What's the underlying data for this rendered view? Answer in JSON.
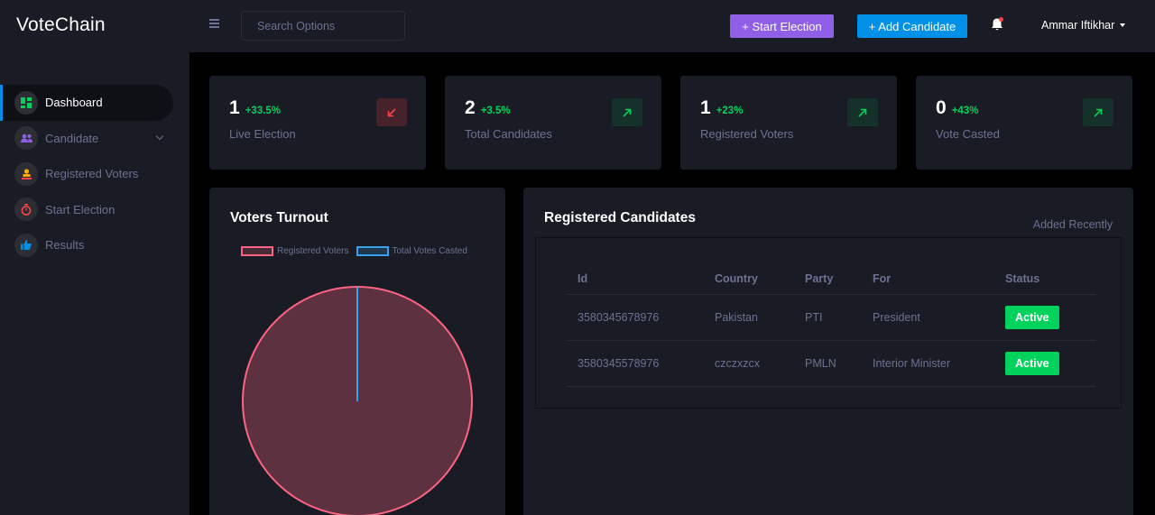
{
  "brand": "VoteChain",
  "sidebar": {
    "items": [
      {
        "label": "Dashboard",
        "icon": "grid-icon",
        "active": true
      },
      {
        "label": "Candidate",
        "icon": "users-icon",
        "has_dropdown": true
      },
      {
        "label": "Registered Voters",
        "icon": "voter-icon"
      },
      {
        "label": "Start Election",
        "icon": "timer-icon"
      },
      {
        "label": "Results",
        "icon": "thumbs-up-icon"
      }
    ]
  },
  "topbar": {
    "search_placeholder": "Search Options",
    "start_election_label": "+ Start Election",
    "add_candidate_label": "+ Add Candidate",
    "user_name": "Ammar Iftikhar"
  },
  "stats": [
    {
      "value": "1",
      "change": "+33.5%",
      "label": "Live Election",
      "trend": "down"
    },
    {
      "value": "2",
      "change": "+3.5%",
      "label": "Total Candidates",
      "trend": "up"
    },
    {
      "value": "1",
      "change": "+23%",
      "label": "Registered Voters",
      "trend": "up"
    },
    {
      "value": "0",
      "change": "+43%",
      "label": "Vote Casted",
      "trend": "up"
    }
  ],
  "turnout": {
    "title": "Voters Turnout",
    "chart_data": {
      "type": "pie",
      "labels": [
        "Registered Voters",
        "Total Votes Casted"
      ],
      "values": [
        1,
        0
      ],
      "colors": [
        "#ff6384",
        "#36a2eb"
      ],
      "legend": "top"
    }
  },
  "candidates": {
    "title": "Registered Candidates",
    "subtitle": "Added Recently",
    "columns": [
      "Id",
      "Country",
      "Party",
      "For",
      "Status"
    ],
    "rows": [
      {
        "id": "3580345678976",
        "country": "Pakistan",
        "party": "PTI",
        "for": "President",
        "status": "Active"
      },
      {
        "id": "3580345578976",
        "country": "czczxzcx",
        "party": "PMLN",
        "for": "Interior Minister",
        "status": "Active"
      }
    ]
  },
  "colors": {
    "accent_purple": "#8f5fe8",
    "accent_blue": "#0090e7",
    "success": "#00d25b",
    "danger": "#fc424a",
    "card_bg": "#191c24"
  }
}
